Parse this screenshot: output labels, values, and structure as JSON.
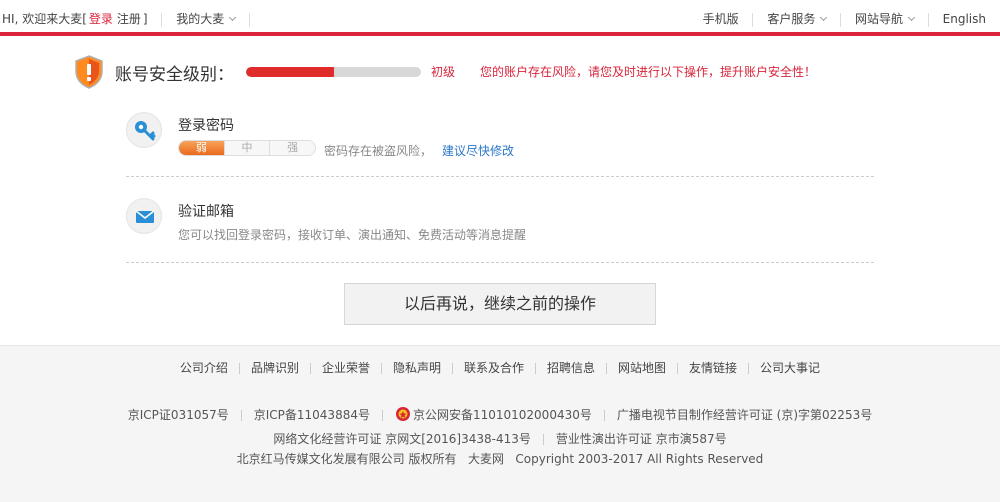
{
  "topbar": {
    "greeting": "HI, 欢迎来大麦[",
    "login": "登录",
    "register": "注册",
    "close_bracket": "]",
    "my_damai": "我的大麦",
    "mobile": "手机版",
    "service": "客户服务",
    "site_nav": "网站导航",
    "english": "English"
  },
  "security": {
    "title": "账号安全级别：",
    "progress": 0.5,
    "level": "初级",
    "warning": "您的账户存在风险，请您及时进行以下操作，提升账户安全性！"
  },
  "password": {
    "title": "登录密码",
    "strength_levels": [
      "弱",
      "中",
      "强"
    ],
    "note": "密码存在被盗风险，",
    "link": "建议尽快修改"
  },
  "email": {
    "title": "验证邮箱",
    "note": "您可以找回登录密码，接收订单、演出通知、免费活动等消息提醒"
  },
  "continue_label": "以后再说，继续之前的操作",
  "footer": {
    "links": [
      "公司介绍",
      "品牌识别",
      "企业荣誉",
      "隐私声明",
      "联系及合作",
      "招聘信息",
      "网站地图",
      "友情链接",
      "公司大事记"
    ],
    "icp1": "京ICP证031057号",
    "icp2": "京ICP备11043884号",
    "police": "京公网安备11010102000430号",
    "broadcast": "广播电视节目制作经营许可证 (京)字第02253号",
    "culture": "网络文化经营许可证 京网文[2016]3438-413号",
    "perform": "营业性演出许可证 京市演587号",
    "company": "北京红马传媒文化发展有限公司 版权所有",
    "damai": "大麦网",
    "copyright": "Copyright 2003-2017 All Rights Reserved"
  },
  "colors": {
    "accent": "#d9243b",
    "progress_fill": "#e02b2b",
    "link": "#2a77c9"
  }
}
